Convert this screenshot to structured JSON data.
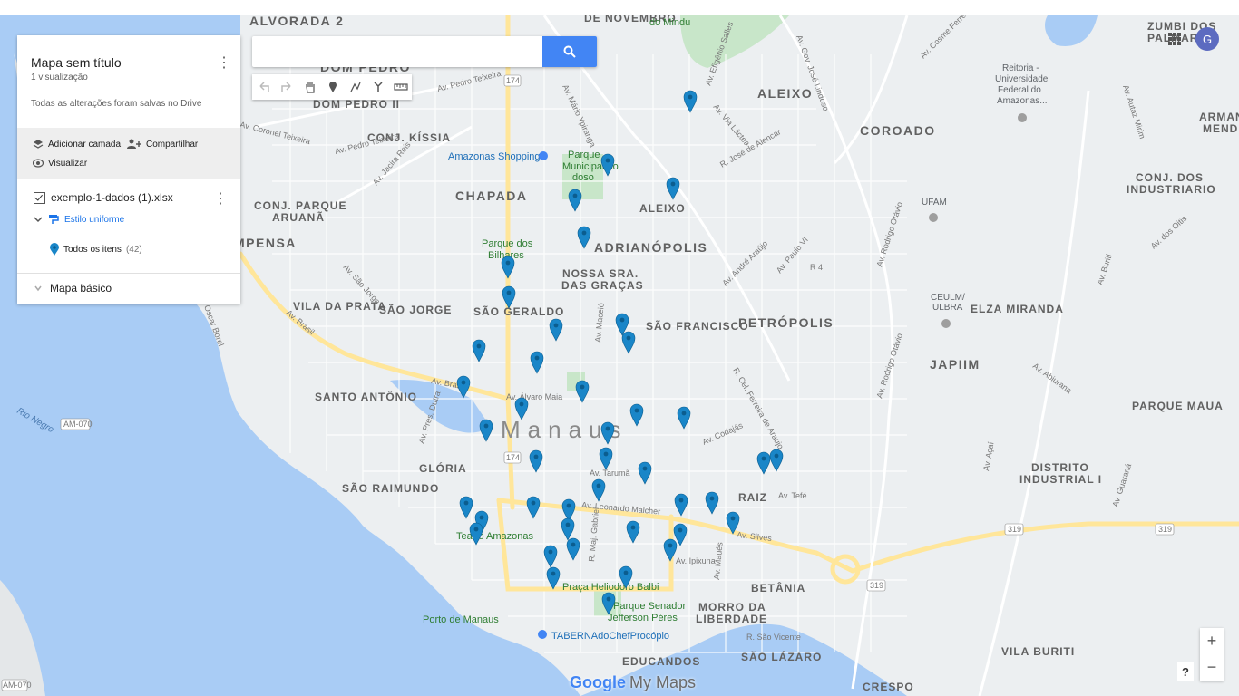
{
  "panel": {
    "title": "Mapa sem título",
    "views": "1 visualização",
    "save_status": "Todas as alterações foram salvas no Drive",
    "add_layer": "Adicionar camada",
    "share": "Compartilhar",
    "preview": "Visualizar",
    "layer_name": "exemplo-1-dados (1).xlsx",
    "style_label": "Estilo uniforme",
    "items_label": "Todos os itens",
    "items_count": "(42)",
    "basemap_label": "Mapa básico"
  },
  "search": {
    "placeholder": "",
    "value": ""
  },
  "account": {
    "avatar_letter": "G"
  },
  "zoom": {
    "in": "+",
    "out": "−"
  },
  "help": "?",
  "logo": {
    "google": "Google",
    "product": "My Maps"
  },
  "map": {
    "city": "Manaus",
    "neighborhoods": {
      "alvorada": "ALVORADA 2",
      "dom_pedro": "DOM PEDRO",
      "dom_pedro_ii": "DOM PEDRO II",
      "aleixo_big": "ALEIXO",
      "aleixo_small": "ALEIXO",
      "coroado": "COROADO",
      "conj_kissia": "CONJ. KÍSSIA",
      "chapada": "CHAPADA",
      "conj_parque_aruana_1": "CONJ. PARQUE",
      "conj_parque_aruana_2": "ARUANÃ",
      "compensa": "MPENSA",
      "adrianopolis": "ADRIANÓPOLIS",
      "nossa_sra_1": "NOSSA SRA.",
      "nossa_sra_2": "DAS GRAÇAS",
      "vila_da_prata": "VILA DA PRATA",
      "sao_jorge": "SÃO JORGE",
      "sao_geraldo": "SÃO GERALDO",
      "sao_francisco": "SÃO FRANCISCO",
      "petropolis": "PETRÓPOLIS",
      "japiim": "JAPIIM",
      "elza_miranda": "ELZA MIRANDA",
      "santo_antonio": "SANTO ANTÔNIO",
      "parque_maua": "PARQUE MAUA",
      "gloria": "GLÓRIA",
      "sao_raimundo": "SÃO RAIMUNDO",
      "raiz": "RAIZ",
      "distrito_1": "DISTRITO",
      "distrito_2": "INDUSTRIAL I",
      "betania": "BETÂNIA",
      "morro_1": "MORRO DA",
      "morro_2": "LIBERDADE",
      "sao_lazaro": "SÃO LÁZARO",
      "educandos": "EDUCANDOS",
      "vila_buriti": "VILA BURITI",
      "crespo": "CRESPO",
      "conj_industriario_1": "CONJ. DOS",
      "conj_industriario_2": "INDUSTRIARIO",
      "zumbi_1": "ZUMBI DOS",
      "zumbi_2": "PALMARES",
      "armando_1": "ARMANI",
      "armando_2": "MENDE",
      "novembro": "DE NOVEMBRO"
    },
    "pois": {
      "amazonas_shopping": "Amazonas Shopping",
      "parque_idoso_1": "Parque",
      "parque_idoso_2": "Municipal do",
      "parque_idoso_3": "Idoso",
      "parque_bilhares_1": "Parque dos",
      "parque_bilhares_2": "Bilhares",
      "teatro": "Teatro Amazonas",
      "praca": "Praça Heliodoro Balbi",
      "parque_senador_1": "Parque Senador",
      "parque_senador_2": "Jefferson Péres",
      "porto": "Porto de Manaus",
      "taberna": "TABERNAdoChefProcópio",
      "ufam": "UFAM",
      "ceulm_1": "CEULM/",
      "ceulm_2": "ULBRA",
      "reitoria_1": "Reitoria -",
      "reitoria_2": "Universidade",
      "reitoria_3": "Federal do",
      "reitoria_4": "Amazonas...",
      "mindu": "do Mindu"
    },
    "water": {
      "rio_negro": "Rio Negro"
    },
    "shields": {
      "am070": "AM-070",
      "r174": "174",
      "r319": "319"
    },
    "streets": {
      "pedro_teixeira": "Av. Pedro Teixeira",
      "coronel_teixeira": "Av. Coronel Teixeira",
      "jacira_reis": "Av. Jacira Reis",
      "brasil": "Av. Brasil",
      "sao_jorge": "Av. São Jorge",
      "alvaro_maia": "Av. Álvaro Maia",
      "pres_dutra": "Av. Pres. Dutra",
      "tarumã": "Av. Tarumã",
      "leonardo_malcher": "Av. Leonardo Malcher",
      "silves": "Av. Silves",
      "ipixuna": "Av. Ipixuna",
      "codajas": "Av. Codajás",
      "tefe": "Av. Tefé",
      "via_lactea": "Av. Via Láctea",
      "jose_de_alencar": "R. José de Alencar",
      "andre_araujo": "Av. André Araújo",
      "rodrigo_otavio": "Av. Rodrigo Otávio",
      "ferreira_araujo": "R. Cel. Ferreira de Araújo",
      "mario_ypiranga": "Av. Mário Ypiranga",
      "efigenio_salles": "Av. Efigênio Salles",
      "gov_jose_lindoso": "Av. Gov. José Lindoso",
      "buriti": "Av. Buriti",
      "abiurana": "Av. Abiurana",
      "acai": "Av. Açaí",
      "cosme_ferreira": "Av. Cosme Ferreira",
      "autaz_mirim": "Av. Autaz Mirim",
      "dos_oitis": "Av. dos Oitis",
      "guarana": "Av. Guaraná",
      "paulo_vi": "Av. Paulo VI",
      "r4": "R 4",
      "sao_vicente": "R. São Vicente",
      "maues": "Av. Maués",
      "maj_gabriel": "R. Maj. Gabriel",
      "macei": "Av. Maceió",
      "oscar_borel": "Oscar Borel"
    },
    "markers": [
      {
        "lng": 761,
        "lat": 112
      },
      {
        "lng": 670,
        "lat": 182
      },
      {
        "lng": 742,
        "lat": 208
      },
      {
        "lng": 634,
        "lat": 221
      },
      {
        "lng": 644,
        "lat": 262
      },
      {
        "lng": 560,
        "lat": 295
      },
      {
        "lng": 561,
        "lat": 328
      },
      {
        "lng": 613,
        "lat": 364
      },
      {
        "lng": 686,
        "lat": 358
      },
      {
        "lng": 693,
        "lat": 378
      },
      {
        "lng": 528,
        "lat": 387
      },
      {
        "lng": 592,
        "lat": 400
      },
      {
        "lng": 511,
        "lat": 427
      },
      {
        "lng": 642,
        "lat": 432
      },
      {
        "lng": 575,
        "lat": 451
      },
      {
        "lng": 702,
        "lat": 458
      },
      {
        "lng": 754,
        "lat": 461
      },
      {
        "lng": 536,
        "lat": 475
      },
      {
        "lng": 670,
        "lat": 478
      },
      {
        "lng": 591,
        "lat": 509
      },
      {
        "lng": 668,
        "lat": 506
      },
      {
        "lng": 711,
        "lat": 522
      },
      {
        "lng": 842,
        "lat": 511
      },
      {
        "lng": 856,
        "lat": 508
      },
      {
        "lng": 660,
        "lat": 541
      },
      {
        "lng": 514,
        "lat": 560
      },
      {
        "lng": 588,
        "lat": 560
      },
      {
        "lng": 627,
        "lat": 563
      },
      {
        "lng": 751,
        "lat": 557
      },
      {
        "lng": 785,
        "lat": 555
      },
      {
        "lng": 531,
        "lat": 576
      },
      {
        "lng": 525,
        "lat": 589
      },
      {
        "lng": 626,
        "lat": 584
      },
      {
        "lng": 698,
        "lat": 587
      },
      {
        "lng": 750,
        "lat": 590
      },
      {
        "lng": 808,
        "lat": 577
      },
      {
        "lng": 632,
        "lat": 606
      },
      {
        "lng": 607,
        "lat": 614
      },
      {
        "lng": 739,
        "lat": 607
      },
      {
        "lng": 610,
        "lat": 638
      },
      {
        "lng": 690,
        "lat": 637
      },
      {
        "lng": 671,
        "lat": 666
      }
    ]
  },
  "colors": {
    "water": "#a9ccf5",
    "land": "#eceff1",
    "road_major": "#ffe69a",
    "park": "#c8e6c9",
    "marker": "#1a86c8",
    "accent": "#4285f4"
  }
}
